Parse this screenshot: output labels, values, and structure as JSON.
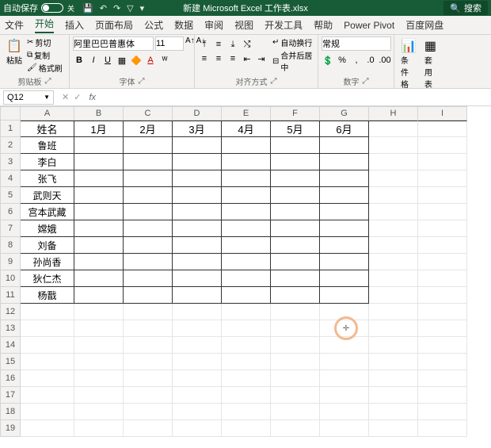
{
  "titlebar": {
    "autoSave": "自动保存",
    "off": "关",
    "doc": "新建 Microsoft Excel 工作表.xlsx",
    "search": "搜索"
  },
  "menu": {
    "file": "文件",
    "home": "开始",
    "insert": "插入",
    "layout": "页面布局",
    "formula": "公式",
    "data": "数据",
    "review": "审阅",
    "view": "视图",
    "dev": "开发工具",
    "help": "帮助",
    "pp": "Power Pivot",
    "baidu": "百度网盘"
  },
  "ribbon": {
    "paste": "粘贴",
    "cut": "剪切",
    "copy": "复制",
    "fmtPainter": "格式刷",
    "clipboard": "剪贴板",
    "fontName": "阿里巴巴普惠体",
    "fontSize": "11",
    "fontGroup": "字体",
    "wrap": "自动换行",
    "merge": "合并后居中",
    "alignGroup": "对齐方式",
    "general": "常规",
    "numGroup": "数字",
    "condFmt": "条件格式",
    "tblFmt": "套用表格"
  },
  "nameBox": "Q12",
  "cols": [
    "A",
    "B",
    "C",
    "D",
    "E",
    "F",
    "G",
    "H",
    "I"
  ],
  "headers": [
    "姓名",
    "1月",
    "2月",
    "3月",
    "4月",
    "5月",
    "6月"
  ],
  "names": [
    "鲁班",
    "李白",
    "张飞",
    "武则天",
    "宫本武藏",
    "嫦娥",
    "刘备",
    "孙尚香",
    "狄仁杰",
    "杨戬"
  ],
  "totalRows": 19
}
